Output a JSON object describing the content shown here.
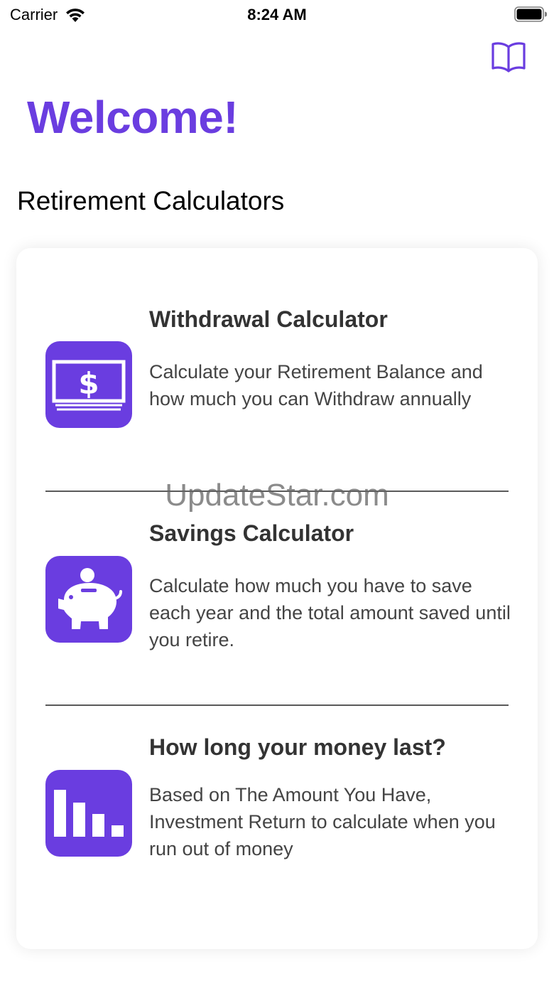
{
  "status_bar": {
    "carrier": "Carrier",
    "time": "8:24 AM"
  },
  "header": {
    "welcome": "Welcome!",
    "section_title": "Retirement Calculators"
  },
  "colors": {
    "accent": "#6a3de0",
    "title_text": "#333333",
    "body_text": "#444444"
  },
  "calculators": [
    {
      "icon": "dollar-bill-icon",
      "title": "Withdrawal Calculator",
      "description": "Calculate your Retirement Balance and how much you can Withdraw annually"
    },
    {
      "icon": "piggy-bank-icon",
      "title": "Savings Calculator",
      "description": "Calculate how much you have to save each year and the total amount saved until you retire."
    },
    {
      "icon": "bar-chart-icon",
      "title": "How long your money last?",
      "description": "Based on The Amount You Have, Investment Return to calculate when you run out of money"
    }
  ],
  "watermark": "UpdateStar.com"
}
